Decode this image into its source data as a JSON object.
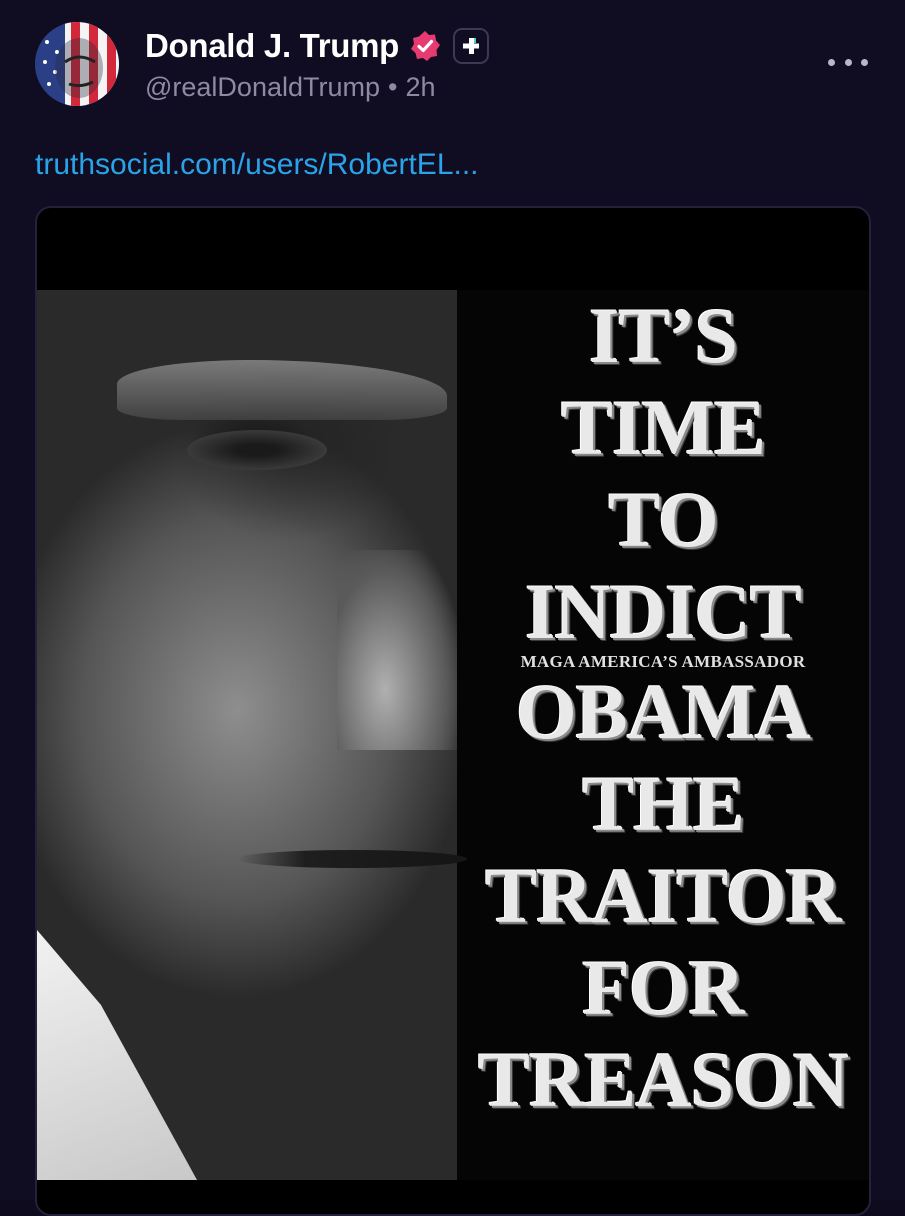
{
  "post": {
    "author": {
      "display_name": "Donald J. Trump",
      "handle": "@realDonaldTrump",
      "time_ago": "2h",
      "separator": "•",
      "verified_icon": "verified-badge-icon",
      "plus_icon": "plus-badge-icon",
      "avatar": "avatar-flag-portrait"
    },
    "more_icon": "more-horizontal-icon",
    "link_text": "truthsocial.com/users/RobertEL...",
    "media": {
      "poster_lines": [
        "IT’S",
        "TIME",
        "TO",
        "INDICT"
      ],
      "poster_subtitle": "MAGA AMERICA’S AMBASSADOR",
      "poster_lines_2": [
        "OBAMA",
        "THE",
        "TRAITOR",
        "FOR",
        "TREASON"
      ]
    }
  },
  "colors": {
    "background": "#100c21",
    "link": "#2aa3e8",
    "handle": "#8d8aa3",
    "verified": "#e63a73"
  }
}
